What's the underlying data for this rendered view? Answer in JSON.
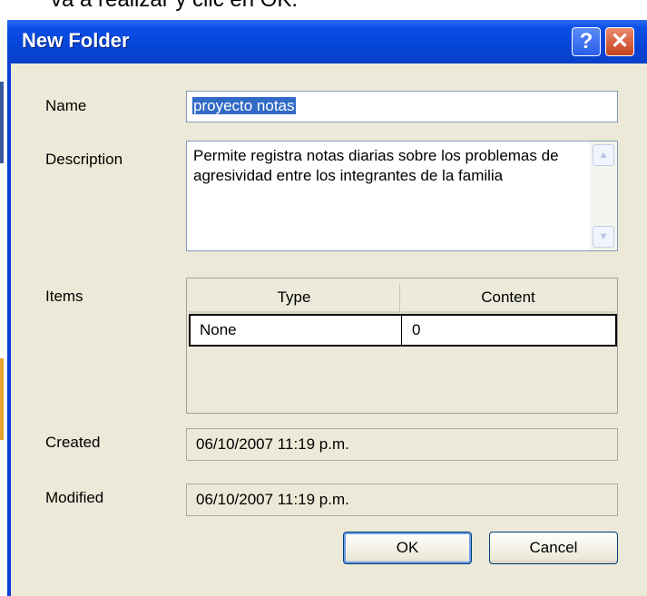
{
  "background": {
    "caption": "va a realizar y clic en OK."
  },
  "dialog": {
    "title": "New Folder",
    "help_glyph": "?",
    "close_glyph": "✕",
    "labels": {
      "name": "Name",
      "description": "Description",
      "items": "Items",
      "created": "Created",
      "modified": "Modified"
    },
    "name_value": "proyecto notas",
    "description_value": "Permite registra notas diarias sobre los problemas de agresividad entre los integrantes de la familia",
    "items_table": {
      "columns": [
        "Type",
        "Content"
      ],
      "rows": [
        [
          "None",
          "0"
        ]
      ]
    },
    "created_value": "06/10/2007 11:19 p.m.",
    "modified_value": "06/10/2007 11:19 p.m.",
    "buttons": {
      "ok": "OK",
      "cancel": "Cancel"
    }
  },
  "colors": {
    "titlebar": "#0544d8",
    "client": "#ece9d8",
    "selection": "#316ac5"
  },
  "icons": [
    "help-icon",
    "close-icon",
    "scroll-up-icon",
    "scroll-down-icon"
  ]
}
